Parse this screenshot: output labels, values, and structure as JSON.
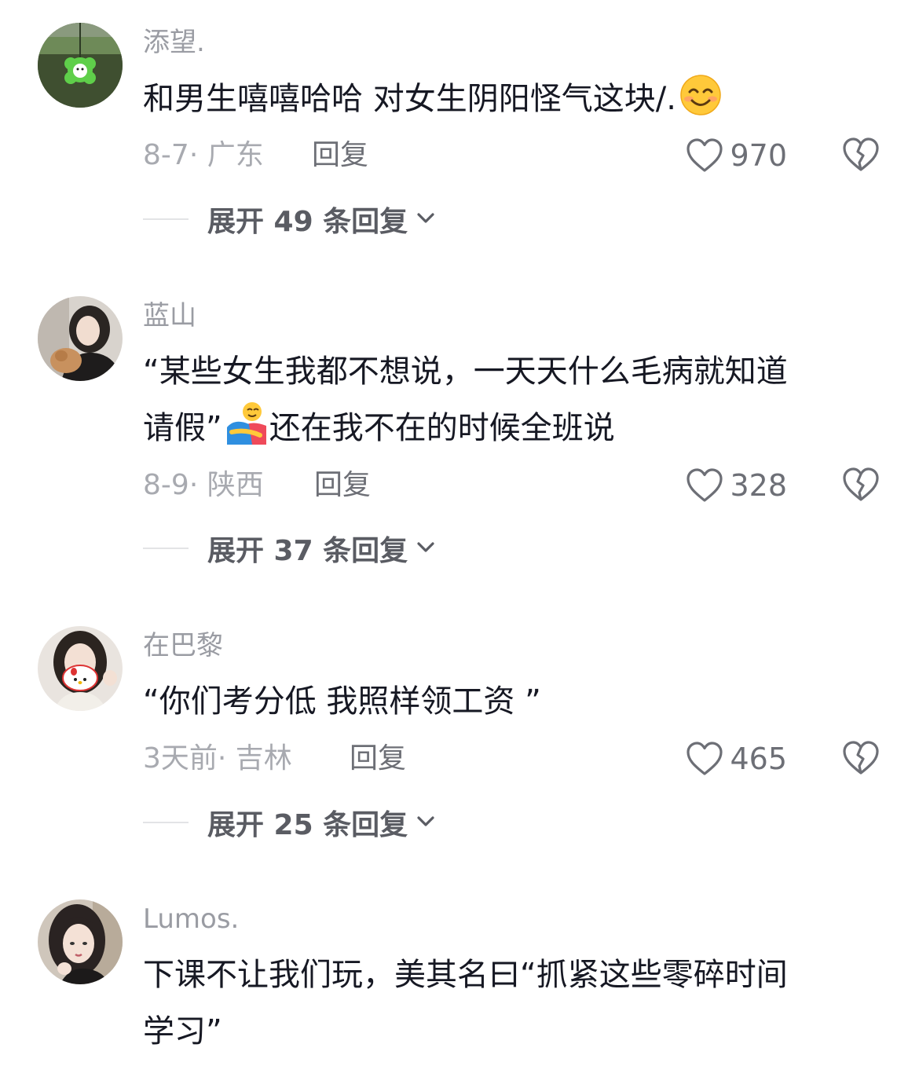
{
  "comments": [
    {
      "username": "添望.",
      "text": "和男生嘻嘻哈哈 对女生阴阳怪气这块/.",
      "emoji": "smiling-face-emoji",
      "date": "8-7",
      "location": "广东",
      "reply_label": "回复",
      "likes": "970",
      "expand_label": "展开 49 条回复"
    },
    {
      "username": "蓝山",
      "text_line1": "“某些女生我都不想说，一天天什么毛病就知道",
      "text_line2_a": "请假”",
      "emoji": "hugging-people-emoji",
      "text_line2_b": "还在我不在的时候全班说",
      "date": "8-9",
      "location": "陕西",
      "reply_label": "回复",
      "likes": "328",
      "expand_label": "展开 37 条回复"
    },
    {
      "username": "在巴黎",
      "text": "“你们考分低 我照样领工资 ”",
      "date": "3天前",
      "location": "吉林",
      "reply_label": "回复",
      "likes": "465",
      "expand_label": "展开 25 条回复"
    },
    {
      "username": "Lumos.",
      "text_line1": "下课不让我们玩，美其名曰“抓紧这些零碎时间",
      "text_line2": "学习”"
    }
  ],
  "meta_separator": "· ",
  "icons": {
    "like": "heart-outline-icon",
    "dislike": "broken-heart-icon",
    "expand": "chevron-down-icon"
  },
  "colors": {
    "username": "#9a9ca3",
    "body_text": "#161823",
    "meta_text": "#a8aab0",
    "action_text": "#6d6f76"
  }
}
